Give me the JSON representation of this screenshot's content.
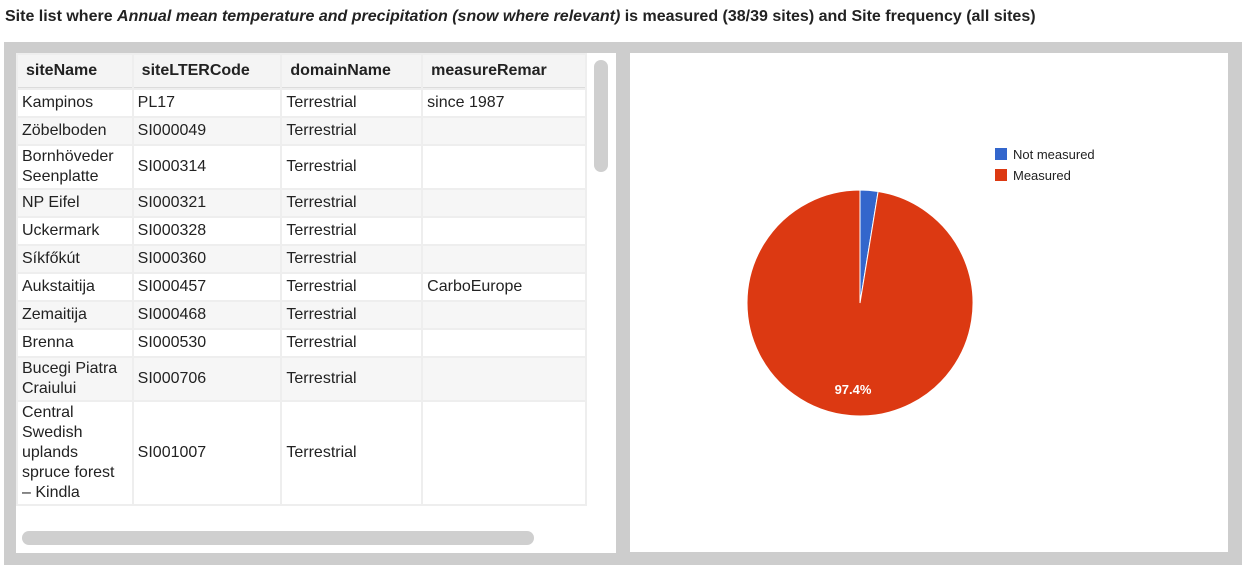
{
  "title": {
    "prefix": "Site list where ",
    "emphasis": "Annual mean temperature and precipitation (snow where relevant)",
    "suffix": " is measured (38/39 sites) and Site frequency (all sites)"
  },
  "table": {
    "columns": [
      "siteName",
      "siteLTERCode",
      "domainName",
      "measureRemar"
    ],
    "rows": [
      {
        "name": "Kampinos",
        "code": "PL17",
        "domain": "Terrestrial",
        "remark": "since 1987"
      },
      {
        "name": "Zöbelboden",
        "code": "SI000049",
        "domain": "Terrestrial",
        "remark": ""
      },
      {
        "name": "Bornhöveder Seenplatte",
        "code": "SI000314",
        "domain": "Terrestrial",
        "remark": ""
      },
      {
        "name": "NP Eifel",
        "code": "SI000321",
        "domain": "Terrestrial",
        "remark": ""
      },
      {
        "name": "Uckermark",
        "code": "SI000328",
        "domain": "Terrestrial",
        "remark": ""
      },
      {
        "name": "Síkfőkút",
        "code": "SI000360",
        "domain": "Terrestrial",
        "remark": ""
      },
      {
        "name": "Aukstaitija",
        "code": "SI000457",
        "domain": "Terrestrial",
        "remark": "CarboEurope"
      },
      {
        "name": "Zemaitija",
        "code": "SI000468",
        "domain": "Terrestrial",
        "remark": ""
      },
      {
        "name": "Brenna",
        "code": "SI000530",
        "domain": "Terrestrial",
        "remark": ""
      },
      {
        "name": "Bucegi Piatra Craiului",
        "code": "SI000706",
        "domain": "Terrestrial",
        "remark": ""
      },
      {
        "name": "Central Swedish uplands spruce forest – Kindla",
        "code": "SI001007",
        "domain": "Terrestrial",
        "remark": ""
      }
    ]
  },
  "chart_data": {
    "type": "pie",
    "slices": [
      {
        "label": "Not measured",
        "value": 1,
        "percent": 2.6,
        "color": "#3366cc"
      },
      {
        "label": "Measured",
        "value": 38,
        "percent": 97.4,
        "color": "#dc3912"
      }
    ],
    "data_labels": [
      "",
      "97.4%"
    ],
    "legend": "right"
  }
}
